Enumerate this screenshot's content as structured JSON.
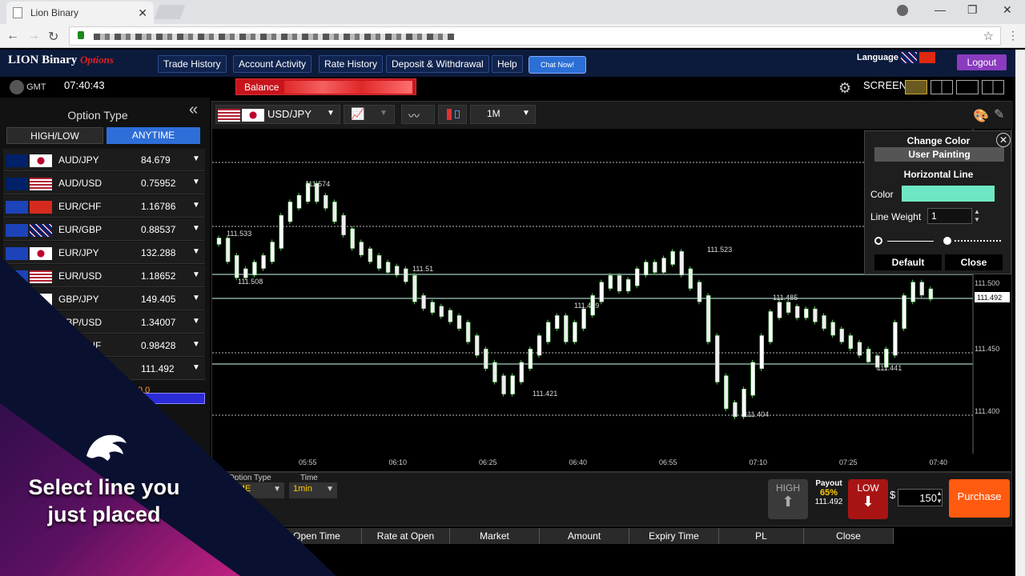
{
  "browser": {
    "tab_title": "Lion Binary",
    "tab_close": "✕",
    "win_min": "—",
    "win_max": "❐",
    "win_close": "✕"
  },
  "header": {
    "logo_main": "LION Binary",
    "logo_sub": "Options",
    "nav": [
      "Trade History",
      "Account Activity",
      "Rate History",
      "Deposit & Withdrawal",
      "Help"
    ],
    "chat": "Chat Now!",
    "language": "Language",
    "logout": "Logout"
  },
  "status": {
    "gmt": "GMT",
    "time": "07:40:43",
    "balance_label": "Balance",
    "screen": "SCREEN"
  },
  "left_panel": {
    "title": "Option Type",
    "collapse": "«",
    "tab_highlow": "HIGH/LOW",
    "tab_anytime": "ANYTIME",
    "pairs": [
      {
        "name": "AUD/JPY",
        "price": "84.679"
      },
      {
        "name": "AUD/USD",
        "price": "0.75952"
      },
      {
        "name": "EUR/CHF",
        "price": "1.16786"
      },
      {
        "name": "EUR/GBP",
        "price": "0.88537"
      },
      {
        "name": "EUR/JPY",
        "price": "132.288"
      },
      {
        "name": "EUR/USD",
        "price": "1.18652"
      },
      {
        "name": "GBP/JPY",
        "price": "149.405"
      },
      {
        "name": "GBP/USD",
        "price": "1.34007"
      },
      {
        "name": "USD/CHF",
        "price": "0.98428"
      },
      {
        "name": "USD/JPY",
        "price": "111.492"
      }
    ],
    "row_value": "0.0"
  },
  "chart": {
    "symbol": "USD/JPY",
    "timeframe": "1M",
    "x_ticks": [
      "05:55",
      "06:10",
      "06:25",
      "06:40",
      "06:55",
      "07:10",
      "07:25",
      "07:40"
    ],
    "y_ticks": [
      "111.500",
      "111.450",
      "111.400"
    ],
    "current_price": "111.492",
    "price_labels": [
      "111.574",
      "111.533",
      "111.508",
      "111.51",
      "111.479",
      "111.421",
      "111.523",
      "111.485",
      "111.441",
      "111.404"
    ]
  },
  "color_panel": {
    "header": "Change Color",
    "close_icon": "✕",
    "user_painting": "User Painting",
    "horizontal_line": "Horizontal Line",
    "color_label": "Color",
    "line_weight_label": "Line Weight",
    "line_weight_value": "1",
    "swatch_color": "#6ee8c4",
    "default_btn": "Default",
    "close_btn": "Close"
  },
  "order": {
    "option_type_label": "Option Type",
    "option_type_value": "TIME",
    "time_label": "Time",
    "time_value": "1min",
    "high": "HIGH",
    "payout_label": "Payout",
    "payout_pct": "65%",
    "payout_rate": "111.492",
    "low": "LOW",
    "currency": "$",
    "amount": "150",
    "purchase": "Purchase"
  },
  "positions": {
    "columns": [
      "Open Time",
      "Rate at Open",
      "Market",
      "Amount",
      "Expiry Time",
      "PL",
      "Close"
    ]
  },
  "overlay": {
    "caption": "Select line you just placed"
  }
}
